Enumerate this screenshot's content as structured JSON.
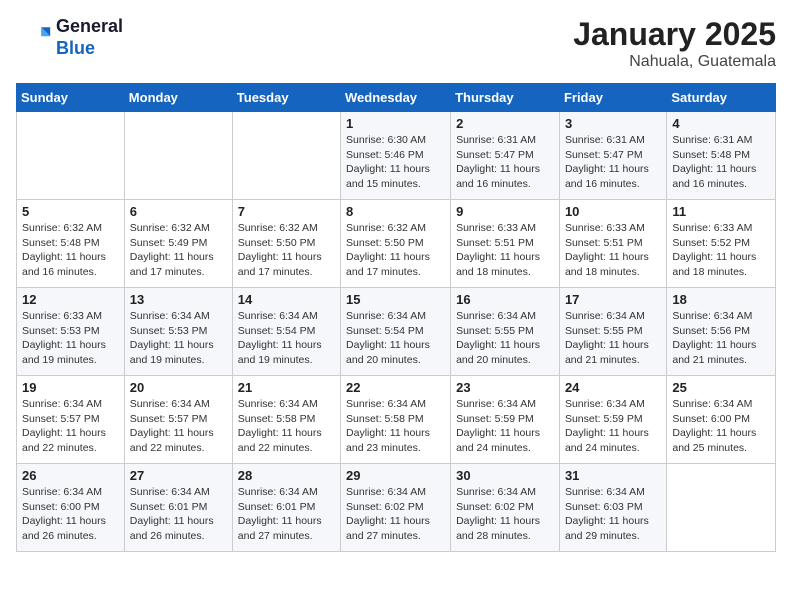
{
  "header": {
    "logo_line1": "General",
    "logo_line2": "Blue",
    "month": "January 2025",
    "location": "Nahuala, Guatemala"
  },
  "days_of_week": [
    "Sunday",
    "Monday",
    "Tuesday",
    "Wednesday",
    "Thursday",
    "Friday",
    "Saturday"
  ],
  "weeks": [
    [
      {
        "num": "",
        "info": ""
      },
      {
        "num": "",
        "info": ""
      },
      {
        "num": "",
        "info": ""
      },
      {
        "num": "1",
        "info": "Sunrise: 6:30 AM\nSunset: 5:46 PM\nDaylight: 11 hours\nand 15 minutes."
      },
      {
        "num": "2",
        "info": "Sunrise: 6:31 AM\nSunset: 5:47 PM\nDaylight: 11 hours\nand 16 minutes."
      },
      {
        "num": "3",
        "info": "Sunrise: 6:31 AM\nSunset: 5:47 PM\nDaylight: 11 hours\nand 16 minutes."
      },
      {
        "num": "4",
        "info": "Sunrise: 6:31 AM\nSunset: 5:48 PM\nDaylight: 11 hours\nand 16 minutes."
      }
    ],
    [
      {
        "num": "5",
        "info": "Sunrise: 6:32 AM\nSunset: 5:48 PM\nDaylight: 11 hours\nand 16 minutes."
      },
      {
        "num": "6",
        "info": "Sunrise: 6:32 AM\nSunset: 5:49 PM\nDaylight: 11 hours\nand 17 minutes."
      },
      {
        "num": "7",
        "info": "Sunrise: 6:32 AM\nSunset: 5:50 PM\nDaylight: 11 hours\nand 17 minutes."
      },
      {
        "num": "8",
        "info": "Sunrise: 6:32 AM\nSunset: 5:50 PM\nDaylight: 11 hours\nand 17 minutes."
      },
      {
        "num": "9",
        "info": "Sunrise: 6:33 AM\nSunset: 5:51 PM\nDaylight: 11 hours\nand 18 minutes."
      },
      {
        "num": "10",
        "info": "Sunrise: 6:33 AM\nSunset: 5:51 PM\nDaylight: 11 hours\nand 18 minutes."
      },
      {
        "num": "11",
        "info": "Sunrise: 6:33 AM\nSunset: 5:52 PM\nDaylight: 11 hours\nand 18 minutes."
      }
    ],
    [
      {
        "num": "12",
        "info": "Sunrise: 6:33 AM\nSunset: 5:53 PM\nDaylight: 11 hours\nand 19 minutes."
      },
      {
        "num": "13",
        "info": "Sunrise: 6:34 AM\nSunset: 5:53 PM\nDaylight: 11 hours\nand 19 minutes."
      },
      {
        "num": "14",
        "info": "Sunrise: 6:34 AM\nSunset: 5:54 PM\nDaylight: 11 hours\nand 19 minutes."
      },
      {
        "num": "15",
        "info": "Sunrise: 6:34 AM\nSunset: 5:54 PM\nDaylight: 11 hours\nand 20 minutes."
      },
      {
        "num": "16",
        "info": "Sunrise: 6:34 AM\nSunset: 5:55 PM\nDaylight: 11 hours\nand 20 minutes."
      },
      {
        "num": "17",
        "info": "Sunrise: 6:34 AM\nSunset: 5:55 PM\nDaylight: 11 hours\nand 21 minutes."
      },
      {
        "num": "18",
        "info": "Sunrise: 6:34 AM\nSunset: 5:56 PM\nDaylight: 11 hours\nand 21 minutes."
      }
    ],
    [
      {
        "num": "19",
        "info": "Sunrise: 6:34 AM\nSunset: 5:57 PM\nDaylight: 11 hours\nand 22 minutes."
      },
      {
        "num": "20",
        "info": "Sunrise: 6:34 AM\nSunset: 5:57 PM\nDaylight: 11 hours\nand 22 minutes."
      },
      {
        "num": "21",
        "info": "Sunrise: 6:34 AM\nSunset: 5:58 PM\nDaylight: 11 hours\nand 22 minutes."
      },
      {
        "num": "22",
        "info": "Sunrise: 6:34 AM\nSunset: 5:58 PM\nDaylight: 11 hours\nand 23 minutes."
      },
      {
        "num": "23",
        "info": "Sunrise: 6:34 AM\nSunset: 5:59 PM\nDaylight: 11 hours\nand 24 minutes."
      },
      {
        "num": "24",
        "info": "Sunrise: 6:34 AM\nSunset: 5:59 PM\nDaylight: 11 hours\nand 24 minutes."
      },
      {
        "num": "25",
        "info": "Sunrise: 6:34 AM\nSunset: 6:00 PM\nDaylight: 11 hours\nand 25 minutes."
      }
    ],
    [
      {
        "num": "26",
        "info": "Sunrise: 6:34 AM\nSunset: 6:00 PM\nDaylight: 11 hours\nand 26 minutes."
      },
      {
        "num": "27",
        "info": "Sunrise: 6:34 AM\nSunset: 6:01 PM\nDaylight: 11 hours\nand 26 minutes."
      },
      {
        "num": "28",
        "info": "Sunrise: 6:34 AM\nSunset: 6:01 PM\nDaylight: 11 hours\nand 27 minutes."
      },
      {
        "num": "29",
        "info": "Sunrise: 6:34 AM\nSunset: 6:02 PM\nDaylight: 11 hours\nand 27 minutes."
      },
      {
        "num": "30",
        "info": "Sunrise: 6:34 AM\nSunset: 6:02 PM\nDaylight: 11 hours\nand 28 minutes."
      },
      {
        "num": "31",
        "info": "Sunrise: 6:34 AM\nSunset: 6:03 PM\nDaylight: 11 hours\nand 29 minutes."
      },
      {
        "num": "",
        "info": ""
      }
    ]
  ]
}
